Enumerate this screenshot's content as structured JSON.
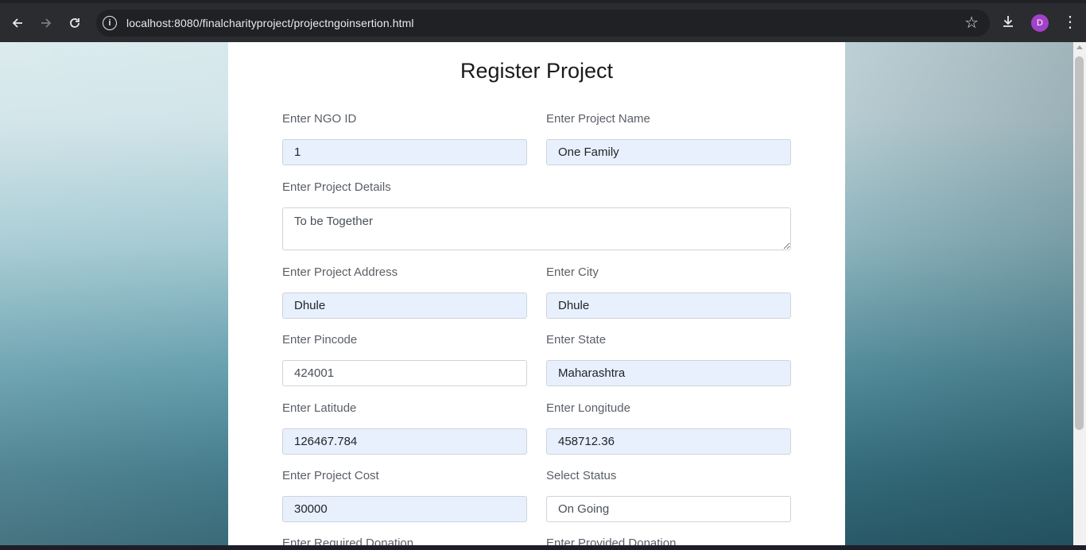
{
  "browser": {
    "url": "localhost:8080/finalcharityproject/projectngoinsertion.html",
    "avatar_letter": "D"
  },
  "form": {
    "title": "Register Project",
    "fields": {
      "ngo_id": {
        "label": "Enter NGO ID",
        "value": "1"
      },
      "project_name": {
        "label": "Enter Project Name",
        "value": "One Family"
      },
      "project_details": {
        "label": "Enter Project Details",
        "value": "To be Together"
      },
      "project_address": {
        "label": "Enter Project Address",
        "value": "Dhule"
      },
      "city": {
        "label": "Enter City",
        "value": "Dhule"
      },
      "pincode": {
        "label": "Enter Pincode",
        "value": "424001"
      },
      "state": {
        "label": "Enter State",
        "value": "Maharashtra"
      },
      "latitude": {
        "label": "Enter Latitude",
        "value": "126467.784"
      },
      "longitude": {
        "label": "Enter Longitude",
        "value": "458712.36"
      },
      "project_cost": {
        "label": "Enter Project Cost",
        "value": "30000"
      },
      "status": {
        "label": "Select Status",
        "value": "On Going"
      },
      "required_donation": {
        "label": "Enter Required Donation"
      },
      "provided_donation": {
        "label": "Enter Provided Donation"
      }
    }
  },
  "colors": {
    "autofill_bg": "#e8f0fe",
    "card_bg": "#ffffff",
    "chrome_bg": "#2b2c30"
  }
}
